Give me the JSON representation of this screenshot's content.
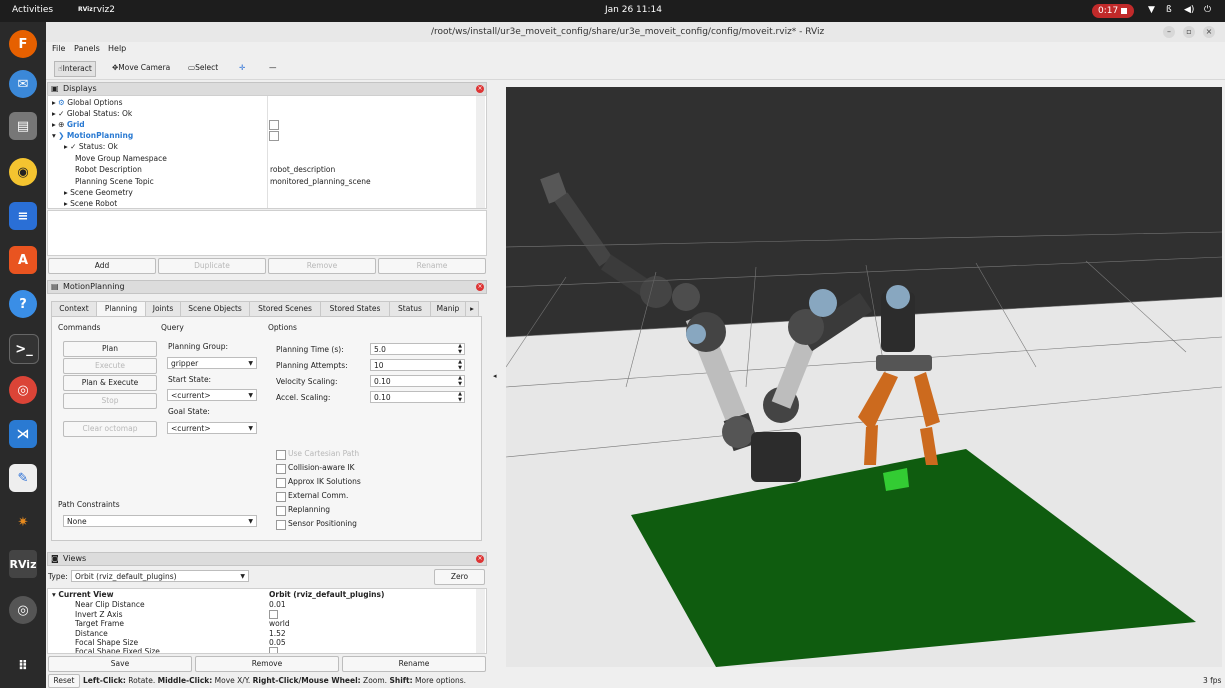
{
  "topbar": {
    "activities": "Activities",
    "app": "rviz2",
    "app_icon": "RViz",
    "clock": "Jan 26  11:14",
    "record": "0:17"
  },
  "window": {
    "title": "/root/ws/install/ur3e_moveit_config/share/ur3e_moveit_config/config/moveit.rviz* - RViz"
  },
  "menu": {
    "file": "File",
    "panels": "Panels",
    "help": "Help"
  },
  "toolbar": {
    "interact": "Interact",
    "move_camera": "Move Camera",
    "select": "Select"
  },
  "displays": {
    "title": "Displays",
    "rows": [
      {
        "name": "Global Options",
        "value": ""
      },
      {
        "name": "Global Status: Ok",
        "value": ""
      },
      {
        "name": "Grid",
        "value": ""
      },
      {
        "name": "MotionPlanning",
        "value": ""
      },
      {
        "name": "Status: Ok",
        "value": ""
      },
      {
        "name": "Move Group Namespace",
        "value": ""
      },
      {
        "name": "Robot Description",
        "value": "robot_description"
      },
      {
        "name": "Planning Scene Topic",
        "value": "monitored_planning_scene"
      },
      {
        "name": "Scene Geometry",
        "value": ""
      },
      {
        "name": "Scene Robot",
        "value": ""
      }
    ],
    "buttons": {
      "add": "Add",
      "duplicate": "Duplicate",
      "remove": "Remove",
      "rename": "Rename"
    }
  },
  "motion": {
    "title": "MotionPlanning",
    "tabs": [
      "Context",
      "Planning",
      "Joints",
      "Scene Objects",
      "Stored Scenes",
      "Stored States",
      "Status",
      "Manip"
    ],
    "commands_title": "Commands",
    "commands": {
      "plan": "Plan",
      "execute": "Execute",
      "plan_execute": "Plan & Execute",
      "stop": "Stop",
      "clear": "Clear octomap"
    },
    "query_title": "Query",
    "planning_group_label": "Planning Group:",
    "planning_group": "gripper",
    "start_state_label": "Start State:",
    "start_state": "<current>",
    "goal_state_label": "Goal State:",
    "goal_state": "<current>",
    "options_title": "Options",
    "planning_time_label": "Planning Time (s):",
    "planning_time": "5.0",
    "planning_attempts_label": "Planning Attempts:",
    "planning_attempts": "10",
    "velocity_label": "Velocity Scaling:",
    "velocity": "0.10",
    "accel_label": "Accel. Scaling:",
    "accel": "0.10",
    "checks": [
      "Use Cartesian Path",
      "Collision-aware IK",
      "Approx IK Solutions",
      "External Comm.",
      "Replanning",
      "Sensor Positioning"
    ],
    "path_constraints_label": "Path Constraints",
    "path_constraints": "None"
  },
  "views": {
    "title": "Views",
    "type_label": "Type:",
    "type_value": "Orbit (rviz_default_plugins)",
    "zero": "Zero",
    "rows": [
      {
        "name": "Current View",
        "value": "Orbit (rviz_default_plugins)"
      },
      {
        "name": "Near Clip Distance",
        "value": "0.01"
      },
      {
        "name": "Invert Z Axis",
        "value": ""
      },
      {
        "name": "Target Frame",
        "value": "world"
      },
      {
        "name": "Distance",
        "value": "1.52"
      },
      {
        "name": "Focal Shape Size",
        "value": "0.05"
      },
      {
        "name": "Focal Shape Fixed Size",
        "value": ""
      }
    ],
    "buttons": {
      "save": "Save",
      "remove": "Remove",
      "rename": "Rename"
    }
  },
  "status": {
    "reset": "Reset",
    "left_click": "Left-Click:",
    "left_desc": " Rotate. ",
    "middle_click": "Middle-Click:",
    "middle_desc": " Move X/Y. ",
    "right_click": "Right-Click/Mouse Wheel:",
    "right_desc": " Zoom. ",
    "shift": "Shift:",
    "shift_desc": " More options.",
    "fps": "3 fps"
  }
}
